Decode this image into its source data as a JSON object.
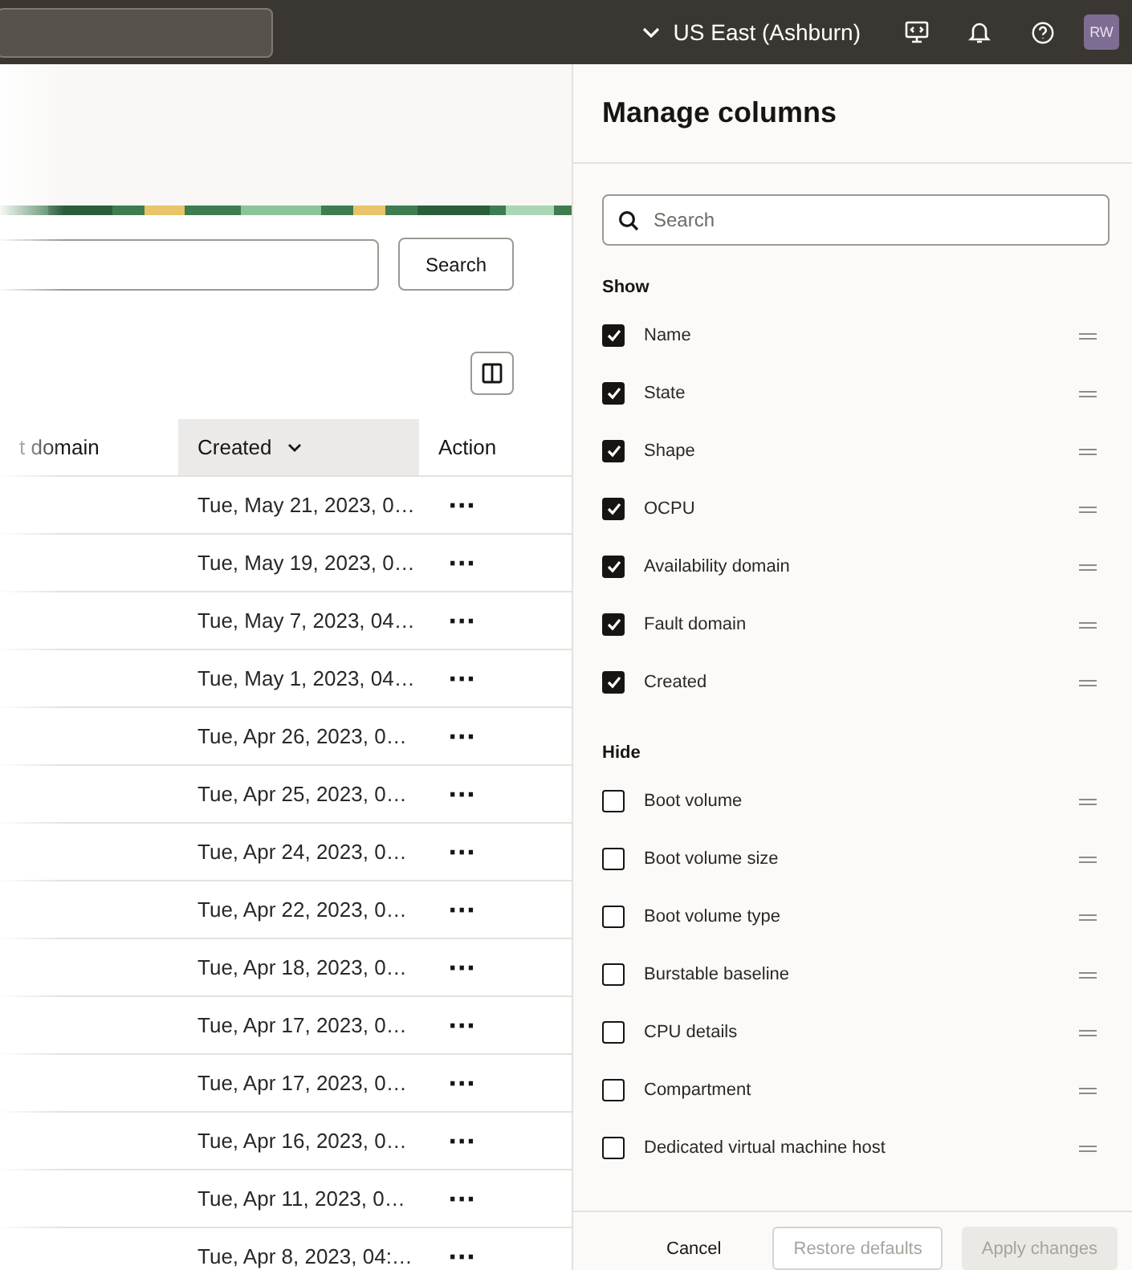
{
  "topbar": {
    "region": "US East (Ashburn)",
    "avatar": "RW"
  },
  "search": {
    "button": "Search"
  },
  "table": {
    "columns": [
      {
        "label": "t domain",
        "sorted": false
      },
      {
        "label": "Created",
        "sorted": true
      },
      {
        "label": "Action",
        "sorted": false
      }
    ],
    "rows": [
      {
        "created": "Tue, May 21, 2023, 0…",
        "action": "···"
      },
      {
        "created": "Tue, May 19, 2023, 0…",
        "action": "···"
      },
      {
        "created": "Tue, May 7, 2023, 04…",
        "action": "···"
      },
      {
        "created": "Tue, May 1, 2023, 04…",
        "action": "···"
      },
      {
        "created": "Tue, Apr 26, 2023, 0…",
        "action": "···"
      },
      {
        "created": "Tue, Apr 25, 2023, 0…",
        "action": "···"
      },
      {
        "created": "Tue, Apr 24, 2023, 0…",
        "action": "···"
      },
      {
        "created": "Tue, Apr 22, 2023, 0…",
        "action": "···"
      },
      {
        "created": "Tue, Apr 18, 2023, 0…",
        "action": "···"
      },
      {
        "created": "Tue, Apr 17, 2023, 0…",
        "action": "···"
      },
      {
        "created": "Tue, Apr 17, 2023, 0…",
        "action": "···"
      },
      {
        "created": "Tue, Apr 16, 2023, 0…",
        "action": "···"
      },
      {
        "created": "Tue, Apr 11, 2023, 0…",
        "action": "···"
      },
      {
        "created": "Tue, Apr 8, 2023, 04:…",
        "action": "···"
      }
    ]
  },
  "panel": {
    "title": "Manage columns",
    "search_placeholder": "Search",
    "groups": [
      {
        "title": "Show",
        "items": [
          {
            "label": "Name",
            "checked": true
          },
          {
            "label": "State",
            "checked": true
          },
          {
            "label": "Shape",
            "checked": true
          },
          {
            "label": "OCPU",
            "checked": true
          },
          {
            "label": "Availability domain",
            "checked": true
          },
          {
            "label": "Fault domain",
            "checked": true
          },
          {
            "label": "Created",
            "checked": true
          }
        ]
      },
      {
        "title": "Hide",
        "items": [
          {
            "label": "Boot volume",
            "checked": false
          },
          {
            "label": "Boot volume size",
            "checked": false
          },
          {
            "label": "Boot volume type",
            "checked": false
          },
          {
            "label": "Burstable baseline",
            "checked": false
          },
          {
            "label": "CPU details",
            "checked": false
          },
          {
            "label": "Compartment",
            "checked": false
          },
          {
            "label": "Dedicated virtual machine host",
            "checked": false
          }
        ]
      }
    ],
    "buttons": [
      {
        "label": "Cancel",
        "kind": "link",
        "disabled": false
      },
      {
        "label": "Restore defaults",
        "kind": "outline",
        "disabled": true
      },
      {
        "label": "Apply changes",
        "kind": "solid",
        "disabled": true
      }
    ]
  }
}
